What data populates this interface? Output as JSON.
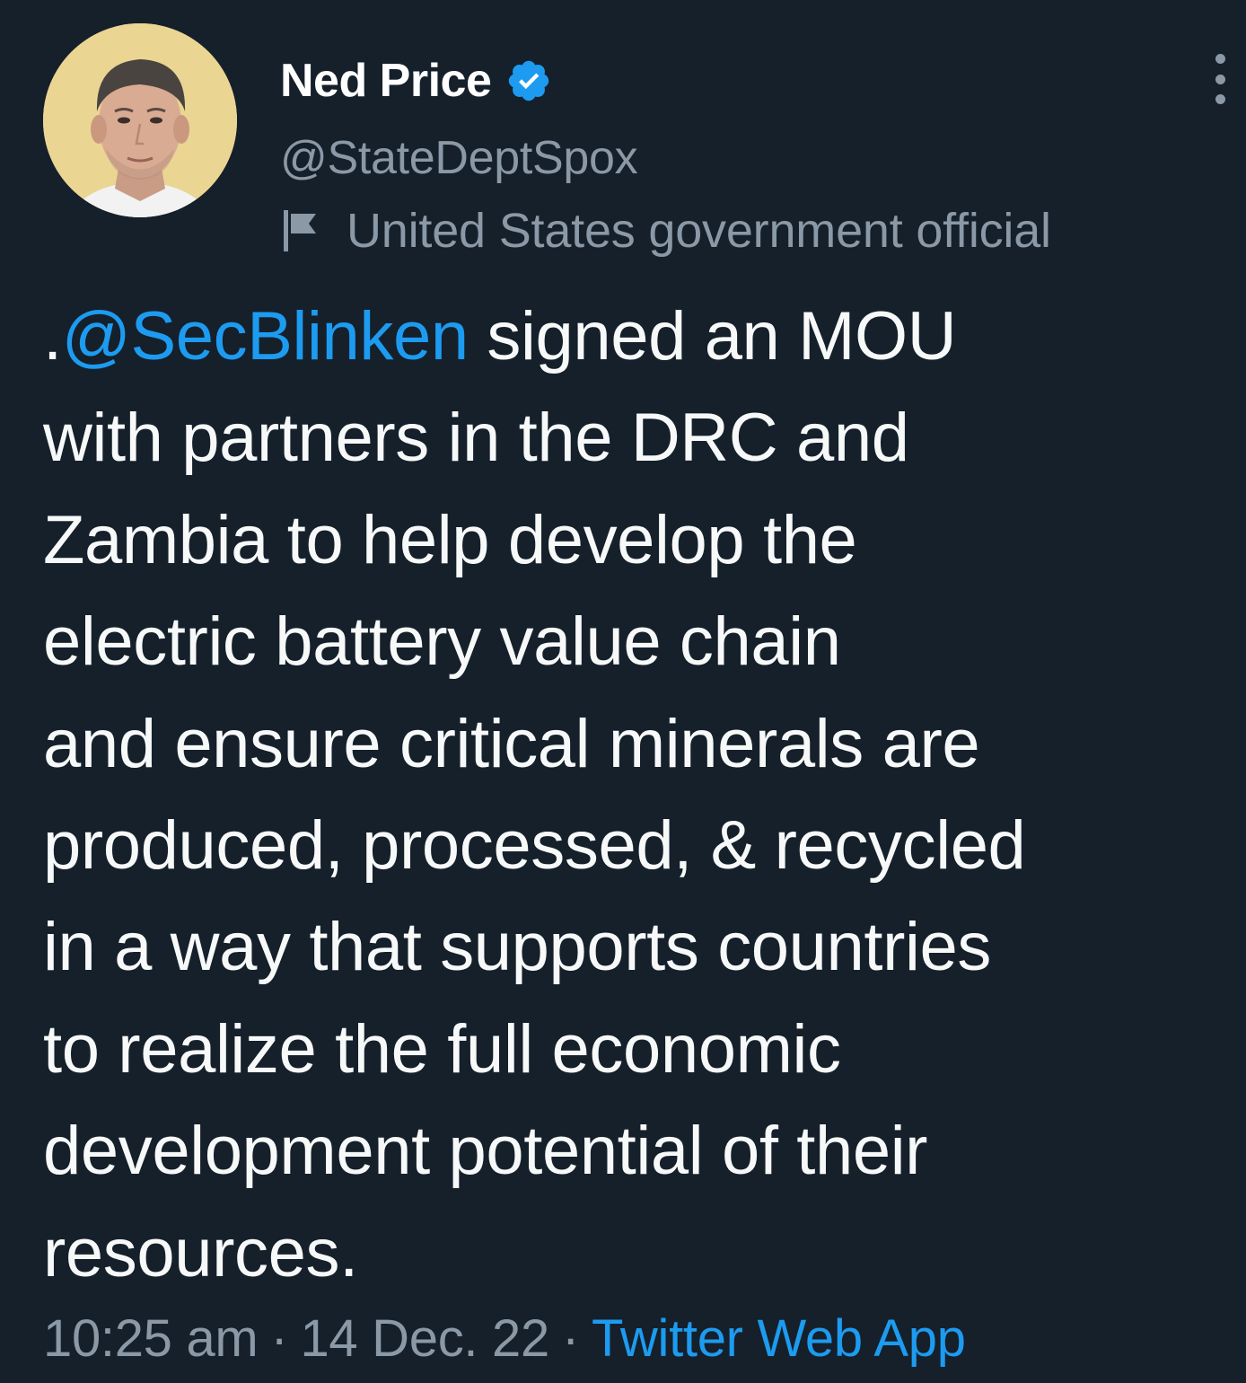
{
  "tweet": {
    "author": {
      "display_name": "Ned Price",
      "handle": "@StateDeptSpox",
      "verified": true,
      "verified_icon": "verified-badge-icon",
      "affiliation_label": "United States government official",
      "affiliation_icon": "flag-icon"
    },
    "body": {
      "prefix": ".",
      "mention": "@SecBlinken",
      "first_line_rest": " signed an MOU",
      "lines": [
        "with partners in the DRC and",
        "Zambia to help develop the",
        "electric battery value chain",
        "and ensure critical minerals are",
        "produced, processed, & recycled",
        "in a way that supports countries",
        "to realize the full economic",
        "development potential of their",
        "resources."
      ]
    },
    "meta": {
      "time": "10:25 am",
      "separator": "·",
      "date": "14 Dec. 22",
      "source": "Twitter Web App"
    },
    "more_icon": "more-vertical-icon"
  },
  "colors": {
    "background": "#15202b",
    "text_primary": "#f7f9f9",
    "text_secondary": "#8b98a5",
    "accent": "#1d9bf0"
  }
}
